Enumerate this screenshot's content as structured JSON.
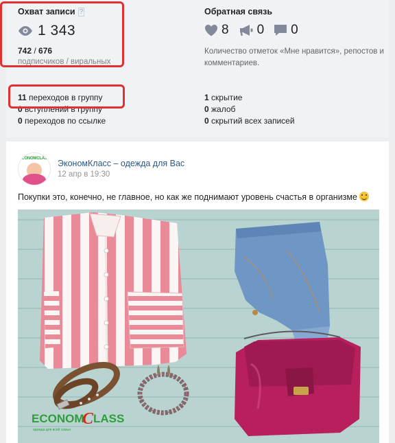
{
  "reach": {
    "title": "Охват записи",
    "help": "?",
    "views": "1 343",
    "subscribers": "742",
    "separator": " / ",
    "viral": "676",
    "label": "подписчиков / виральных"
  },
  "feedback": {
    "title": "Обратная связь",
    "likes": "8",
    "reposts": "0",
    "comments": "0",
    "description": "Количество отметок «Мне нравится», репостов и комментариев."
  },
  "stats_left": [
    {
      "value": "11",
      "label": " переходов в группу"
    },
    {
      "value": "0",
      "label": " вступлений в группу"
    },
    {
      "value": "0",
      "label": " переходов по ссылке"
    }
  ],
  "stats_right": [
    {
      "value": "1",
      "label": " скрытие"
    },
    {
      "value": "0",
      "label": " жалоб"
    },
    {
      "value": "0",
      "label": " скрытий всех записей"
    }
  ],
  "post": {
    "author": "ЭкономКласс – одежда для Вас",
    "date": "12 апр в 19:30",
    "text": "Покупки это, конечно, не главное, но как же поднимают уровень счастья в организме",
    "avatar_logo": "ECONOMCLASS",
    "photo_logo_a": "ECONOM",
    "photo_logo_c": "C",
    "photo_logo_b": "LASS",
    "photo_tagline": "одежда для всей семьи"
  },
  "colors": {
    "link": "#2a5885",
    "highlight": "#e03030",
    "icon": "#828a99",
    "brand_red": "#e2231a",
    "brand_green": "#2e9e3a"
  }
}
